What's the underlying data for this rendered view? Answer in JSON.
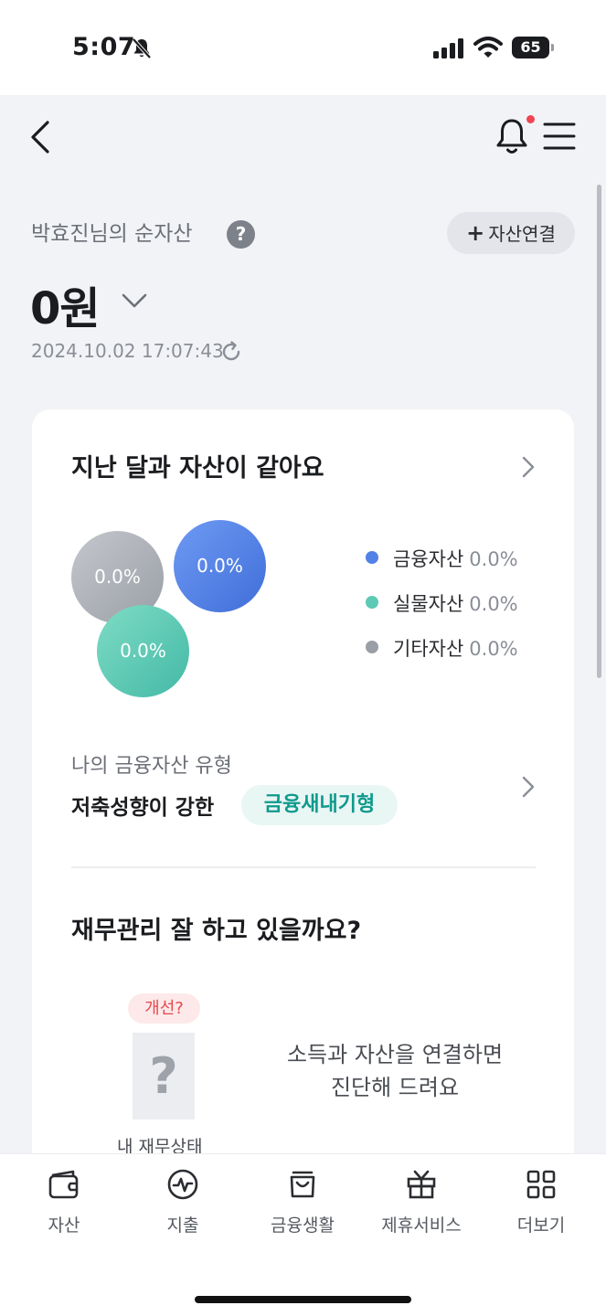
{
  "status_bar": {
    "time": "5:07",
    "battery": "65"
  },
  "header": {
    "notification_dot_color": "#f04452"
  },
  "summary": {
    "label": "박효진님의 순자산",
    "help": "?",
    "connect_button": "자산연결",
    "connect_plus": "+",
    "amount": "0원",
    "timestamp": "2024.10.02 17:07:43"
  },
  "asset_card": {
    "title": "지난 달과 자산이 같아요",
    "bubbles": [
      {
        "name": "financial",
        "value": "0.0%",
        "color": "#5282e6"
      },
      {
        "name": "other",
        "value": "0.0%",
        "color": "#a9adb3"
      },
      {
        "name": "physical",
        "value": "0.0%",
        "color": "#5ccab4"
      }
    ],
    "legend": [
      {
        "label": "금융자산",
        "value": "0.0%",
        "color": "#5282e6"
      },
      {
        "label": "실물자산",
        "value": "0.0%",
        "color": "#5ccab4"
      },
      {
        "label": "기타자산",
        "value": "0.0%",
        "color": "#9a9ea6"
      }
    ],
    "type_label": "나의 금융자산 유형",
    "type_text": "저축성향이 강한",
    "type_badge": "금융새내기형"
  },
  "finance_check": {
    "title": "재무관리 잘 하고 있을까요?",
    "badge": "개선?",
    "doc_mark": "?",
    "doc_caption": "내 재무상태",
    "message_line1": "소득과 자산을 연결하면",
    "message_line2": "진단해 드려요"
  },
  "tabs": [
    {
      "label": "자산",
      "icon": "wallet-icon"
    },
    {
      "label": "지출",
      "icon": "pulse-icon"
    },
    {
      "label": "금융생활",
      "icon": "shopping-bag-icon"
    },
    {
      "label": "제휴서비스",
      "icon": "gift-icon"
    },
    {
      "label": "더보기",
      "icon": "grid-icon"
    }
  ]
}
